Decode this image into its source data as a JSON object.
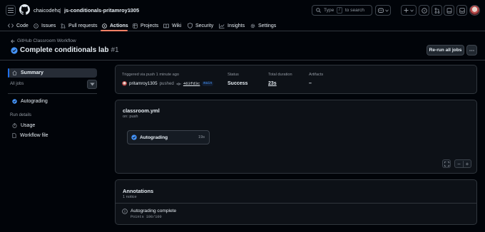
{
  "header": {
    "owner": "chaicodehq",
    "separator": "/",
    "repo": "js-conditionals-pritamroy1305",
    "search_placeholder": "Type",
    "search_key": "/",
    "search_suffix": "to search"
  },
  "tabs": [
    {
      "label": "Code",
      "icon": "code-icon"
    },
    {
      "label": "Issues",
      "icon": "issue-icon"
    },
    {
      "label": "Pull requests",
      "icon": "pull-request-icon"
    },
    {
      "label": "Actions",
      "icon": "play-icon",
      "active": true
    },
    {
      "label": "Projects",
      "icon": "table-icon"
    },
    {
      "label": "Wiki",
      "icon": "book-icon"
    },
    {
      "label": "Security",
      "icon": "shield-icon"
    },
    {
      "label": "Insights",
      "icon": "graph-icon"
    },
    {
      "label": "Settings",
      "icon": "gear-icon"
    }
  ],
  "run": {
    "back_label": "GitHub Classroom Workflow",
    "title": "Complete conditionals lab",
    "number": "#1",
    "rerun_label": "Re-run all jobs"
  },
  "sidebar": {
    "summary_label": "Summary",
    "all_jobs_label": "All jobs",
    "job_label": "Autograding",
    "run_details_label": "Run details",
    "usage_label": "Usage",
    "workflow_file_label": "Workflow file"
  },
  "summary": {
    "trigger_label": "Triggered via push 1 minute ago",
    "actor": "pritamroy1305",
    "pushed_word": "pushed",
    "commit": "463fd3c",
    "branch": "main",
    "status_label": "Status",
    "status_value": "Success",
    "duration_label": "Total duration",
    "duration_value": "23s",
    "artifacts_label": "Artifacts",
    "artifacts_value": "–"
  },
  "workflow": {
    "file_name": "classroom.yml",
    "on_event": "on: push",
    "job_name": "Autograding",
    "job_duration": "19s"
  },
  "annotations": {
    "title": "Annotations",
    "count": "1 notice",
    "notice_title": "Autograding complete",
    "notice_detail": "Points 100/100"
  },
  "colors": {
    "background": "#010409",
    "card": "#0d1117",
    "border": "#30363d",
    "accent_blue": "#1f6feb",
    "success_blue": "#4493f8",
    "tab_underline": "#f78166"
  }
}
